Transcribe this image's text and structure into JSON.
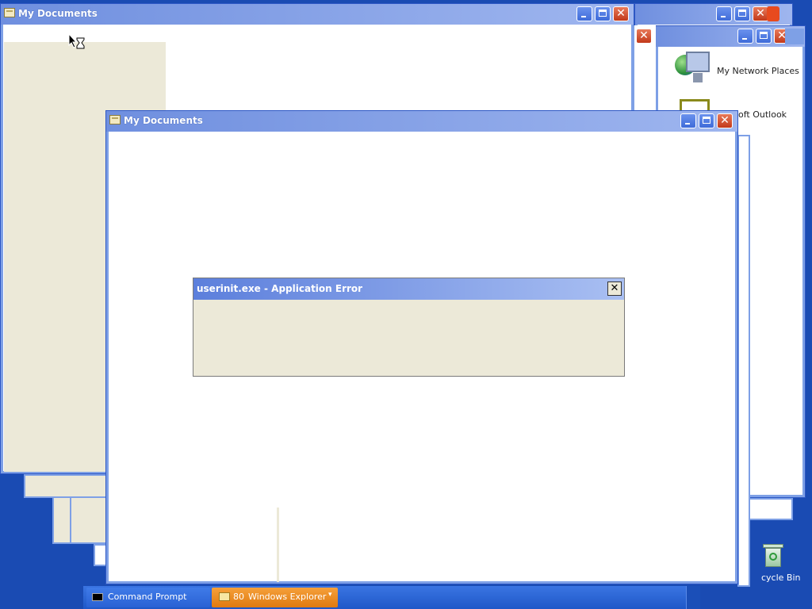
{
  "windows": {
    "back_title": "My Documents",
    "front_title": "My Documents"
  },
  "desktop_icons": {
    "network_places": "My Network Places",
    "outlook": "oft Outlook",
    "recycle_bin": "cycle Bin"
  },
  "dialog": {
    "title": "userinit.exe - Application Error",
    "close_glyph": "✕"
  },
  "taskbar": {
    "cmd_label": "Command Prompt",
    "explorer_count": "80",
    "explorer_label": "Windows Explorer",
    "explorer_arrow": "▾"
  },
  "controls": {
    "close_glyph": "✕"
  },
  "colors": {
    "desktop": "#1a4bb3",
    "title_blue": "#7ea0e6",
    "close_red": "#c2391a",
    "active_task": "#f0891e"
  }
}
